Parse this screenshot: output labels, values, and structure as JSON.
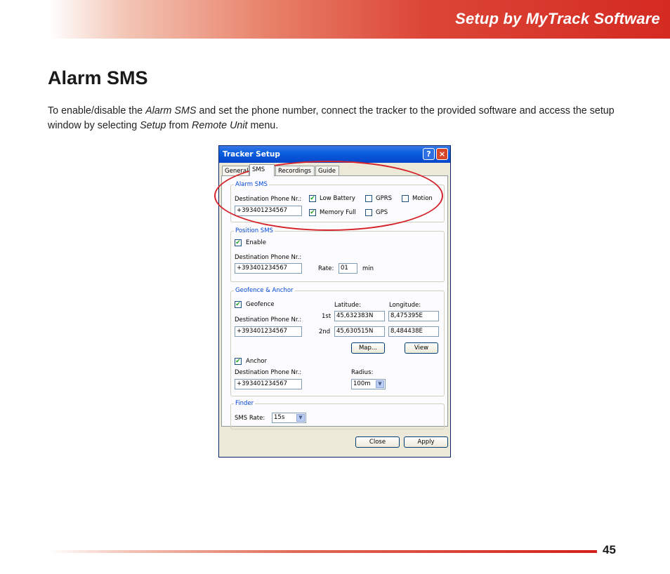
{
  "header": {
    "title": "Setup by MyTrack Software"
  },
  "section": {
    "title": "Alarm SMS"
  },
  "intro": {
    "p1": "To enable/disable the ",
    "alarm_sms": "Alarm SMS",
    "p2": " and set the phone number, connect the tracker to the provided software and access the setup window by selecting ",
    "setup": "Setup",
    "p3": " from ",
    "remote_unit": "Remote Unit",
    "p4": " menu."
  },
  "window": {
    "title": "Tracker Setup",
    "help_label": "?",
    "close_label": "×",
    "tabs": [
      "General",
      "SMS",
      "Recordings",
      "Guide"
    ],
    "active_tab": "SMS",
    "alarm_sms": {
      "label": "Alarm SMS",
      "dest_label": "Destination Phone Nr.:",
      "dest_value": "+393401234567",
      "checks": [
        {
          "label": "Low Battery",
          "checked": true
        },
        {
          "label": "GPRS",
          "checked": false
        },
        {
          "label": "Motion",
          "checked": false
        },
        {
          "label": "Memory Full",
          "checked": true
        },
        {
          "label": "GPS",
          "checked": false
        }
      ]
    },
    "position_sms": {
      "label": "Position SMS",
      "enable_label": "Enable",
      "enable_checked": true,
      "dest_label": "Destination Phone Nr.:",
      "dest_value": "+393401234567",
      "rate_label": "Rate:",
      "rate_value": "01",
      "rate_unit": "min"
    },
    "geofence": {
      "label": "Geofence & Anchor",
      "geofence_label": "Geofence",
      "geofence_checked": true,
      "dest_label": "Destination Phone Nr.:",
      "dest_value": "+393401234567",
      "latitude_label": "Latitude:",
      "longitude_label": "Longitude:",
      "first_label": "1st",
      "second_label": "2nd",
      "lat1": "45,632383N",
      "lon1": "8,475395E",
      "lat2": "45,630515N",
      "lon2": "8,484438E",
      "map_button": "Map...",
      "view_button": "View",
      "anchor_label": "Anchor",
      "anchor_checked": true,
      "anchor_dest_label": "Destination Phone Nr.:",
      "anchor_dest_value": "+393401234567",
      "radius_label": "Radius:",
      "radius_value": "100m"
    },
    "finder": {
      "label": "Finder",
      "sms_rate_label": "SMS Rate:",
      "sms_rate_value": "15s"
    },
    "close_button": "Close",
    "apply_button": "Apply"
  },
  "footer": {
    "page_number": "45"
  },
  "colors": {
    "accent_red": "#d42a22",
    "highlight": "#d4232b",
    "xp_blue": "#0545c9"
  },
  "icons": {
    "check": "✔",
    "dropdown": "▼"
  }
}
